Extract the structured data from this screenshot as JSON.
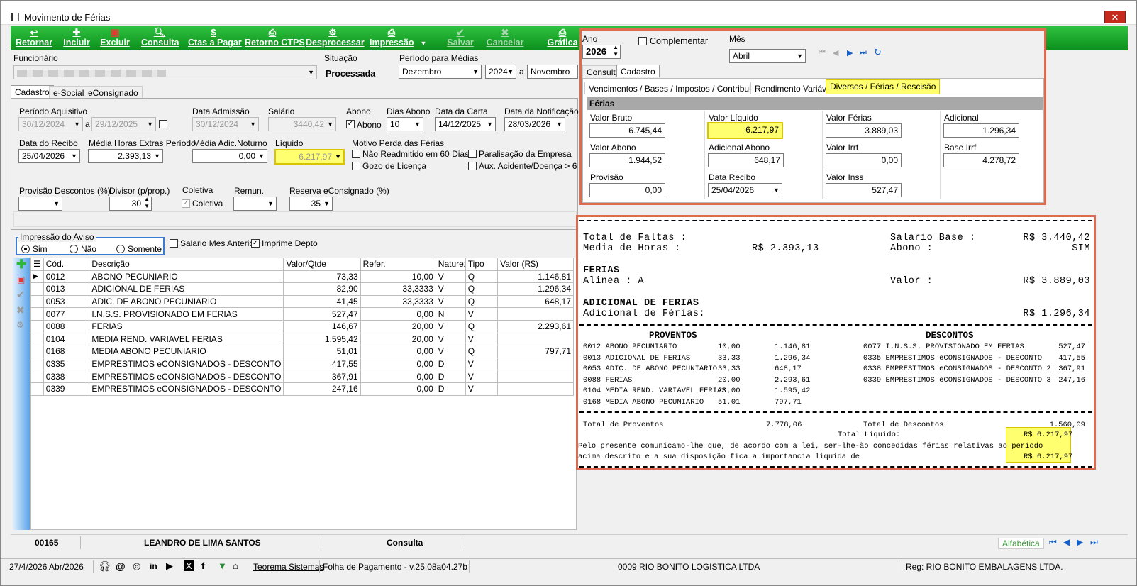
{
  "window": {
    "title": "Movimento de Férias",
    "close": "✕"
  },
  "toolbar": {
    "retornar": "Retornar",
    "incluir": "Incluir",
    "excluir": "Excluir",
    "consulta": "Consulta",
    "ctas_pagar": "Ctas a Pagar",
    "retorno_ctps": "Retorno CTPS",
    "desprocessar": "Desprocessar",
    "impressao": "Impressão",
    "salvar": "Salvar",
    "cancelar": "Cancelar",
    "grafica": "Gráfica"
  },
  "header": {
    "funcionario_label": "Funcionário",
    "situacao_label": "Situação",
    "situacao_value": "Processada",
    "periodo_medias_label": "Período para Médias",
    "periodo_inicio_mes": "Dezembro",
    "periodo_inicio_ano": "2024",
    "periodo_sep": "a",
    "periodo_fim_mes": "Novembro"
  },
  "tabs": {
    "cadastro": "Cadastro",
    "esocial": "e-Social",
    "econsignado": "eConsignado"
  },
  "form": {
    "periodo_aquisitivo_label": "Período Aquisitivo",
    "pa_inicio": "30/12/2024",
    "pa_sep": "a",
    "pa_fim": "29/12/2025",
    "data_admissao_label": "Data Admissão",
    "data_admissao": "30/12/2024",
    "salario_label": "Salário",
    "salario": "3440,42",
    "abono_label": "Abono",
    "abono_check": "Abono",
    "dias_abono_label": "Dias Abono",
    "dias_abono": "10",
    "data_carta_label": "Data da Carta",
    "data_carta": "14/12/2025",
    "data_notificacao_label": "Data da Notificação",
    "data_notificacao": "28/03/2026",
    "data_recibo_label": "Data do Recibo",
    "data_recibo": "25/04/2026",
    "media_he_label": "Média Horas Extras Período",
    "media_he": "2.393,13",
    "media_adic_label": "Média Adic.Noturno",
    "media_adic": "0,00",
    "liquido_label": "Líquido",
    "liquido": "6.217,97",
    "motivo_label": "Motivo Perda das Férias",
    "motivo_nao_readmitido": "Não Readmitido em 60 Dias",
    "motivo_paralisacao": "Paralisação da Empresa",
    "motivo_gozo": "Gozo de Licença",
    "motivo_aux": "Aux. Acidente/Doença > 6",
    "provisao_label": "Provisão Descontos (%)",
    "divisor_label": "Divisor (p/prop.)",
    "divisor": "30",
    "coletiva_label": "Coletiva",
    "coletiva_check": "Coletiva",
    "remun_label": "Remun.",
    "reserva_label": "Reserva eConsignado (%)",
    "reserva": "35"
  },
  "aviso": {
    "group_label": "Impressão do Aviso",
    "sim": "Sim",
    "nao": "Não",
    "somente": "Somente",
    "salario_mes_anterior": "Salario Mes Anterior",
    "imprime_depto": "Imprime Depto"
  },
  "grid": {
    "columns": [
      "Cód.",
      "Descrição",
      "Valor/Qtde",
      "Refer.",
      "Natureza",
      "Tipo",
      "Valor (R$)"
    ],
    "rows": [
      [
        "0012",
        "ABONO PECUNIARIO",
        "73,33",
        "10,00",
        "V",
        "Q",
        "1.146,81"
      ],
      [
        "0013",
        "ADICIONAL DE FERIAS",
        "82,90",
        "33,3333",
        "V",
        "Q",
        "1.296,34"
      ],
      [
        "0053",
        "ADIC. DE ABONO PECUNIARIO",
        "41,45",
        "33,3333",
        "V",
        "Q",
        "648,17"
      ],
      [
        "0077",
        "I.N.S.S. PROVISIONADO EM FERIAS",
        "527,47",
        "0,00",
        "N",
        "V",
        ""
      ],
      [
        "0088",
        "FERIAS",
        "146,67",
        "20,00",
        "V",
        "Q",
        "2.293,61"
      ],
      [
        "0104",
        "MEDIA REND. VARIAVEL  FERIAS",
        "1.595,42",
        "20,00",
        "V",
        "V",
        ""
      ],
      [
        "0168",
        "MEDIA ABONO PECUNIARIO",
        "51,01",
        "0,00",
        "V",
        "Q",
        "797,71"
      ],
      [
        "0335",
        "EMPRESTIMOS eCONSIGNADOS - DESCONTO",
        "417,55",
        "0,00",
        "D",
        "V",
        ""
      ],
      [
        "0338",
        "EMPRESTIMOS eCONSIGNADOS - DESCONTO",
        "367,91",
        "0,00",
        "D",
        "V",
        ""
      ],
      [
        "0339",
        "EMPRESTIMOS eCONSIGNADOS - DESCONTO",
        "247,16",
        "0,00",
        "D",
        "V",
        ""
      ]
    ]
  },
  "overlay": {
    "ano_label": "Ano",
    "ano": "2026",
    "complementar": "Complementar",
    "mes_label": "Mês",
    "mes": "Abril",
    "tab_consulta": "Consulta",
    "tab_cadastro": "Cadastro",
    "sub_venc": "Vencimentos / Bases / Impostos / Contribuições",
    "sub_rend": "Rendimento Variável",
    "sub_div": "Diversos / Férias / Rescisão",
    "ferias_title": "Férias",
    "valor_bruto_label": "Valor Bruto",
    "valor_bruto": "6.745,44",
    "valor_liquido_label": "Valor Líquido",
    "valor_liquido": "6.217,97",
    "valor_ferias_label": "Valor Férias",
    "valor_ferias": "3.889,03",
    "adicional_label": "Adicional",
    "adicional": "1.296,34",
    "valor_abono_label": "Valor Abono",
    "valor_abono": "1.944,52",
    "adicional_abono_label": "Adicional Abono",
    "adicional_abono": "648,17",
    "valor_irrf_label": "Valor Irrf",
    "valor_irrf": "0,00",
    "base_irrf_label": "Base Irrf",
    "base_irrf": "4.278,72",
    "provisao_label": "Provisão",
    "provisao": "0,00",
    "data_recibo_label": "Data Recibo",
    "data_recibo": "25/04/2026",
    "valor_inss_label": "Valor Inss",
    "valor_inss": "527,47"
  },
  "report": {
    "l1a": "Total de Faltas    :",
    "l1b": "Salario Base :",
    "l1c": "R$ 3.440,42",
    "l2a": "Media de Horas     :",
    "l2m": "R$ 2.393,13",
    "l2b": "Abono        :",
    "l2c": "SIM",
    "ferias_h": "FERIAS",
    "alinea": "Alinea             : A",
    "valor_lbl": "Valor        :",
    "valor_val": "R$ 3.889,03",
    "adic_h": "ADICIONAL DE FERIAS",
    "adic_l": "Adicional de Férias:",
    "adic_v": "R$ 1.296,34",
    "proventos_h": "PROVENTOS",
    "descontos_h": "DESCONTOS",
    "proventos": [
      [
        "0012 ABONO PECUNIARIO",
        "10,00",
        "1.146,81"
      ],
      [
        "0013 ADICIONAL DE FERIAS",
        "33,33",
        "1.296,34"
      ],
      [
        "0053 ADIC. DE ABONO PECUNIARIO",
        "33,33",
        "648,17"
      ],
      [
        "0088 FERIAS",
        "20,00",
        "2.293,61"
      ],
      [
        "0104 MEDIA REND. VARIAVEL  FERIAS",
        "20,00",
        "1.595,42"
      ],
      [
        "0168 MEDIA ABONO PECUNIARIO",
        "51,01",
        "797,71"
      ]
    ],
    "descontos": [
      [
        "0077 I.N.S.S. PROVISIONADO EM FERIAS",
        "527,47"
      ],
      [
        "0335 EMPRESTIMOS eCONSIGNADOS - DESCONTO",
        "417,55"
      ],
      [
        "0338 EMPRESTIMOS eCONSIGNADOS - DESCONTO 2",
        "367,91"
      ],
      [
        "0339 EMPRESTIMOS eCONSIGNADOS - DESCONTO 3",
        "247,16"
      ]
    ],
    "tot_prov_l": "Total de Proventos",
    "tot_prov_v": "7.778,06",
    "tot_desc_l": "Total de Descontos",
    "tot_desc_v": "1.560,09",
    "tot_liq_l": "Total Liquido:",
    "tot_liq_v": "R$ 6.217,97",
    "texto1": "Pelo presente comunicamo-lhe que, de acordo com a lei, ser-lhe-ão concedidas férias relativas ao período",
    "texto2": "acima descrito e a sua disposição fica a importancia liquida de",
    "texto_v": "R$ 6.217,97"
  },
  "status": {
    "codigo": "00165",
    "nome": "LEANDRO DE LIMA SANTOS",
    "modo": "Consulta",
    "ordem": "Alfabética"
  },
  "footer": {
    "data": "27/4/2026 Abr/2026",
    "teorema": "Teorema Sistemas",
    "versao": "Folha de Pagamento - v.25.08a04.27b",
    "empresa": "0009 RIO BONITO LOGISTICA LTDA",
    "reg": "Reg: RIO BONITO EMBALAGENS LTDA."
  },
  "colors": {
    "toolbar": "#0b8f1c",
    "highlight": "#ffff70",
    "overlay_border": "#e06a4e",
    "closebtn": "#c42b1c"
  }
}
